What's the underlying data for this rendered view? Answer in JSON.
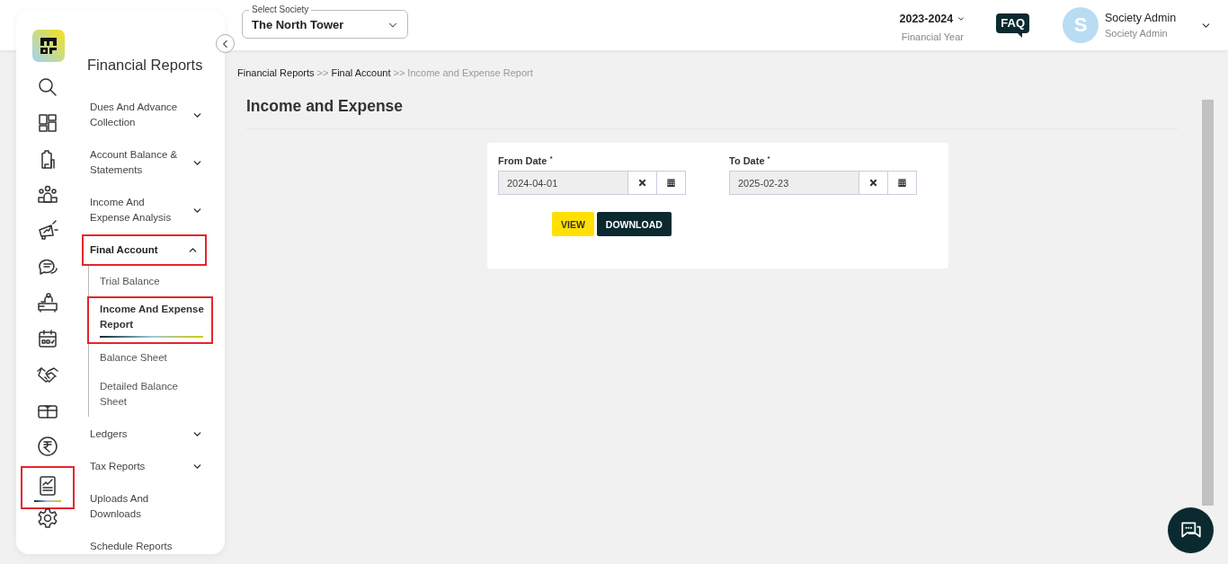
{
  "header": {
    "society_select": {
      "label": "Select Society",
      "value": "The North Tower"
    },
    "financial_year": {
      "value": "2023-2024",
      "caption": "Financial Year"
    },
    "faq": "FAQ",
    "user": {
      "initial": "S",
      "name": "Society Admin",
      "role": "Society Admin"
    }
  },
  "rail": [
    {
      "kind": "search",
      "selected": false,
      "highlighted": false
    },
    {
      "kind": "dashboard",
      "selected": false,
      "highlighted": false
    },
    {
      "kind": "building",
      "selected": false,
      "highlighted": false
    },
    {
      "kind": "people",
      "selected": false,
      "highlighted": false
    },
    {
      "kind": "megaphone",
      "selected": false,
      "highlighted": false
    },
    {
      "kind": "chat",
      "selected": false,
      "highlighted": false
    },
    {
      "kind": "desk",
      "selected": false,
      "highlighted": false
    },
    {
      "kind": "calendar",
      "selected": false,
      "highlighted": false
    },
    {
      "kind": "handshake",
      "selected": false,
      "highlighted": false
    },
    {
      "kind": "box",
      "selected": false,
      "highlighted": false
    },
    {
      "kind": "rupee",
      "selected": false,
      "highlighted": false
    },
    {
      "kind": "report",
      "selected": true,
      "highlighted": true
    },
    {
      "kind": "settings",
      "selected": false,
      "highlighted": false
    }
  ],
  "menu": {
    "title": "Financial Reports",
    "items": [
      {
        "label": "Dues And Advance Collection",
        "kind": "group",
        "expanded": false,
        "highlighted": false
      },
      {
        "label": "Account Balance & Statements",
        "kind": "group",
        "expanded": false,
        "highlighted": false
      },
      {
        "label": "Income And Expense Analysis",
        "kind": "group",
        "expanded": false,
        "highlighted": false
      },
      {
        "label": "Final Account",
        "kind": "group",
        "expanded": true,
        "highlighted": true,
        "children": [
          {
            "label": "Trial Balance",
            "selected": false,
            "highlighted": false
          },
          {
            "label": "Income And Expense Report",
            "selected": true,
            "highlighted": true
          },
          {
            "label": "Balance Sheet",
            "selected": false,
            "highlighted": false
          },
          {
            "label": "Detailed Balance Sheet",
            "selected": false,
            "highlighted": false
          }
        ]
      },
      {
        "label": "Ledgers",
        "kind": "group",
        "expanded": false,
        "highlighted": false
      },
      {
        "label": "Tax Reports",
        "kind": "group",
        "expanded": false,
        "highlighted": false
      },
      {
        "label": "Uploads And Downloads",
        "kind": "link",
        "highlighted": false
      },
      {
        "label": "Schedule Reports",
        "kind": "link",
        "highlighted": false
      }
    ]
  },
  "breadcrumb": {
    "items": [
      {
        "label": "Financial Reports",
        "current": false
      },
      {
        "label": "Final Account",
        "current": false
      },
      {
        "label": "Income and Expense Report",
        "current": true
      }
    ],
    "separators": [
      ">>",
      ">>"
    ]
  },
  "page_title": "Income and Expense",
  "form": {
    "fields": [
      {
        "label": "From Date",
        "required_mark": "*",
        "value": "2024-04-01"
      },
      {
        "label": "To Date",
        "required_mark": "*",
        "value": "2025-02-23"
      }
    ],
    "buttons": [
      {
        "label": "VIEW",
        "kind": "primary"
      },
      {
        "label": "DOWNLOAD",
        "kind": "secondary"
      }
    ]
  }
}
